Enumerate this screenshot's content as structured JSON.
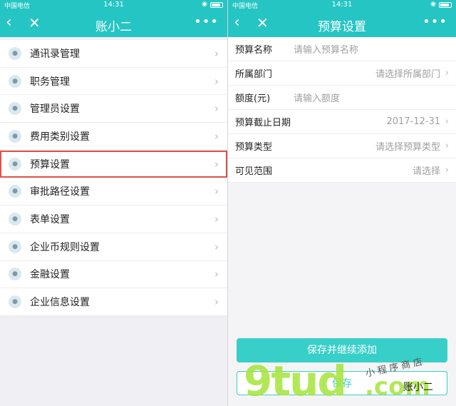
{
  "left": {
    "status": {
      "carrier": "中国电信",
      "time": "14:31"
    },
    "nav": {
      "back": "‹",
      "close": "✕",
      "title": "账小二",
      "more": "•••"
    },
    "menu": [
      {
        "label": "通讯录管理",
        "icon": "address-book-icon"
      },
      {
        "label": "职务管理",
        "icon": "briefcase-icon"
      },
      {
        "label": "管理员设置",
        "icon": "admin-user-icon"
      },
      {
        "label": "费用类别设置",
        "icon": "expense-category-icon"
      },
      {
        "label": "预算设置",
        "icon": "budget-sliders-icon",
        "highlighted": true
      },
      {
        "label": "审批路径设置",
        "icon": "approval-path-icon"
      },
      {
        "label": "表单设置",
        "icon": "form-icon"
      },
      {
        "label": "企业币规则设置",
        "icon": "share-nodes-icon"
      },
      {
        "label": "金融设置",
        "icon": "finance-coin-icon"
      },
      {
        "label": "企业信息设置",
        "icon": "org-chart-icon"
      }
    ],
    "chevron": "›"
  },
  "right": {
    "status": {
      "carrier": "中国电信",
      "time": "14:31"
    },
    "nav": {
      "back": "‹",
      "close": "✕",
      "title": "预算设置",
      "more": "•••"
    },
    "form": [
      {
        "label": "预算名称",
        "value": "请输入预算名称",
        "align": "left",
        "chevron": false
      },
      {
        "label": "所属部门",
        "value": "请选择所属部门",
        "align": "right",
        "chevron": true
      },
      {
        "label": "额度(元)",
        "value": "请输入额度",
        "align": "left",
        "chevron": false
      },
      {
        "label": "预算截止日期",
        "value": "2017-12-31",
        "align": "right",
        "chevron": true
      },
      {
        "label": "预算类型",
        "value": "请选择预算类型",
        "align": "right",
        "chevron": true
      },
      {
        "label": "可见范围",
        "value": "请选择",
        "align": "right",
        "chevron": true
      }
    ],
    "primary_button": "保存并继续添加",
    "secondary_button": "保存"
  },
  "watermark": {
    "site": "9tud",
    "tld": ".com",
    "store": "小程序商店",
    "brand": "账小二"
  },
  "colors": {
    "accent": "#25c5c4",
    "button": "#38cfc8",
    "highlight": "#e0504a"
  }
}
